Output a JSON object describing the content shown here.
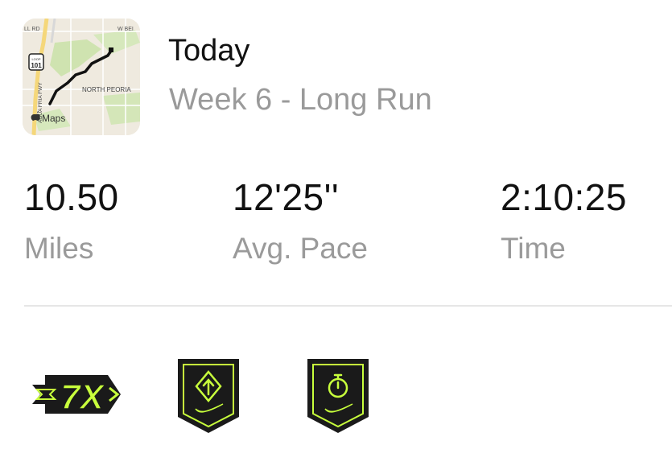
{
  "header": {
    "title": "Today",
    "subtitle": "Week 6 - Long Run"
  },
  "map": {
    "labels": {
      "top_left": "LL RD",
      "top_right": "W BEI",
      "highway": "101",
      "highway_top": "LOOP",
      "area": "NORTH PEORIA",
      "road_vertical": "AGUA FRIA FWY",
      "brand": "Maps"
    },
    "colors": {
      "route": "#111111",
      "land": "#efeadf",
      "park": "#cfe3b0",
      "road": "#f5d77a"
    }
  },
  "stats": [
    {
      "value": "10.50",
      "label": "Miles"
    },
    {
      "value": "12'25''",
      "label": "Avg. Pace"
    },
    {
      "value": "2:10:25",
      "label": "Time"
    }
  ],
  "badges": [
    {
      "name": "7x-streak-badge",
      "text": "7X",
      "icon": "arrow-streak-icon"
    },
    {
      "name": "direction-badge",
      "icon": "direction-arrow-icon"
    },
    {
      "name": "stopwatch-badge",
      "icon": "stopwatch-icon"
    }
  ],
  "colors": {
    "badge_dark": "#1a1a1a",
    "badge_accent": "#c8ff3c"
  }
}
